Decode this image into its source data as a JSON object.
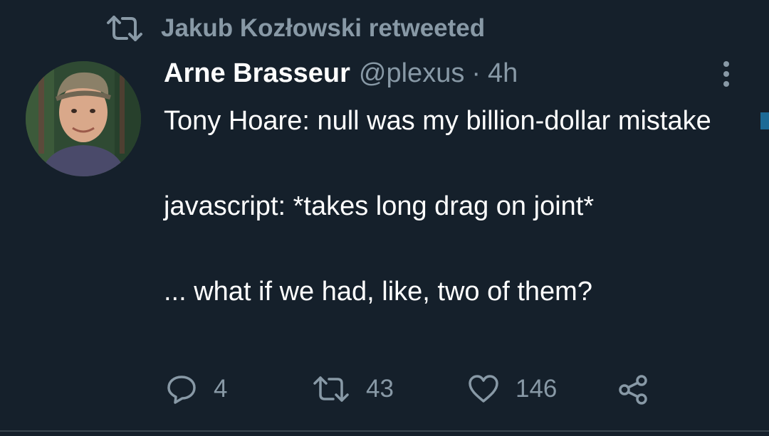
{
  "retweet_banner": {
    "text": "Jakub Kozłowski retweeted",
    "icon": "retweet-icon"
  },
  "tweet": {
    "author": {
      "display_name": "Arne Brasseur",
      "handle": "@plexus",
      "avatar": "avatar-photo"
    },
    "separator": "·",
    "time": "4h",
    "more_icon": "more-vertical-icon",
    "text": {
      "line1": "Tony Hoare: null was my billion-dollar mistake",
      "line2": "javascript: *takes long drag on joint*",
      "line3": "... what if we had, like, two of them?"
    },
    "actions": {
      "reply": {
        "icon": "reply-icon",
        "count": "4"
      },
      "retweet": {
        "icon": "retweet-icon",
        "count": "43"
      },
      "like": {
        "icon": "heart-icon",
        "count": "146"
      },
      "share": {
        "icon": "share-icon"
      }
    }
  },
  "colors": {
    "background": "#15202b",
    "primary_text": "#ffffff",
    "secondary_text": "#8899a6",
    "divider": "#38444d"
  }
}
